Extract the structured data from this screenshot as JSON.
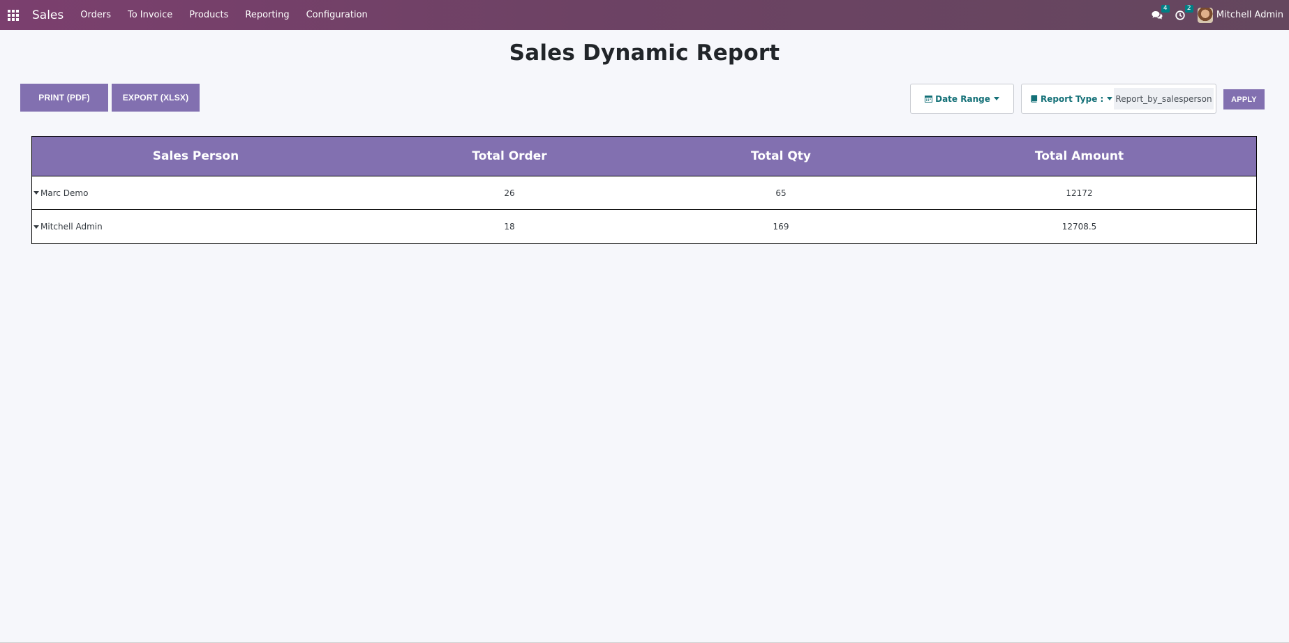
{
  "navbar": {
    "brand": "Sales",
    "menu": [
      "Orders",
      "To Invoice",
      "Products",
      "Reporting",
      "Configuration"
    ],
    "messages_count": "4",
    "activities_count": "2",
    "user_name": "Mitchell Admin"
  },
  "page": {
    "title": "Sales Dynamic Report"
  },
  "actions": {
    "print_label": "PRINT (PDF)",
    "export_label": "EXPORT (XLSX)",
    "apply_label": "APPLY"
  },
  "filters": {
    "date_range_label": "Date Range",
    "report_type_label": "Report Type :",
    "report_type_value": "Report_by_salesperson"
  },
  "table": {
    "headers": [
      "Sales Person",
      "Total Order",
      "Total Qty",
      "Total Amount"
    ],
    "rows": [
      {
        "name": "Marc Demo",
        "total_order": "26",
        "total_qty": "65",
        "total_amount": "12172"
      },
      {
        "name": "Mitchell Admin",
        "total_order": "18",
        "total_qty": "169",
        "total_amount": "12708.5"
      }
    ]
  },
  "colors": {
    "navbar": "#714b67",
    "accent": "#8270b0",
    "link": "#137077",
    "badge": "#017e84"
  }
}
